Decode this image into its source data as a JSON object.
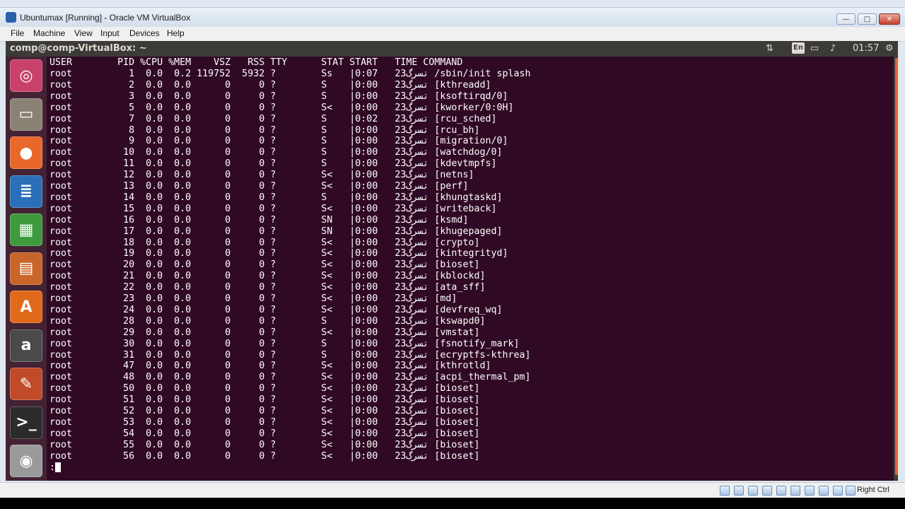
{
  "window": {
    "title": "Ubuntumax [Running] - Oracle VM VirtualBox"
  },
  "menu": [
    "File",
    "Machine",
    "View",
    "Input",
    "Devices",
    "Help"
  ],
  "ubuntu_bar": {
    "title": "comp@comp-VirtualBox: ~",
    "lang": "En",
    "time": "01:57"
  },
  "terminal": {
    "header": "USER        PID %CPU %MEM    VSZ   RSS TTY      STAT START   TIME COMMAND",
    "rows": [
      "root          1  0.0  0.2 119752  5932 ?        Ss   |تسرگ23   0:07 /sbin/init splash",
      "root          2  0.0  0.0      0     0 ?        S    |تسرگ23   0:00 [kthreadd]",
      "root          3  0.0  0.0      0     0 ?        S    |تسرگ23   0:00 [ksoftirqd/0]",
      "root          5  0.0  0.0      0     0 ?        S<   |تسرگ23   0:00 [kworker/0:0H]",
      "root          7  0.0  0.0      0     0 ?        S    |تسرگ23   0:02 [rcu_sched]",
      "root          8  0.0  0.0      0     0 ?        S    |تسرگ23   0:00 [rcu_bh]",
      "root          9  0.0  0.0      0     0 ?        S    |تسرگ23   0:00 [migration/0]",
      "root         10  0.0  0.0      0     0 ?        S    |تسرگ23   0:00 [watchdog/0]",
      "root         11  0.0  0.0      0     0 ?        S    |تسرگ23   0:00 [kdevtmpfs]",
      "root         12  0.0  0.0      0     0 ?        S<   |تسرگ23   0:00 [netns]",
      "root         13  0.0  0.0      0     0 ?        S<   |تسرگ23   0:00 [perf]",
      "root         14  0.0  0.0      0     0 ?        S    |تسرگ23   0:00 [khungtaskd]",
      "root         15  0.0  0.0      0     0 ?        S<   |تسرگ23   0:00 [writeback]",
      "root         16  0.0  0.0      0     0 ?        SN   |تسرگ23   0:00 [ksmd]",
      "root         17  0.0  0.0      0     0 ?        SN   |تسرگ23   0:00 [khugepaged]",
      "root         18  0.0  0.0      0     0 ?        S<   |تسرگ23   0:00 [crypto]",
      "root         19  0.0  0.0      0     0 ?        S<   |تسرگ23   0:00 [kintegrityd]",
      "root         20  0.0  0.0      0     0 ?        S<   |تسرگ23   0:00 [bioset]",
      "root         21  0.0  0.0      0     0 ?        S<   |تسرگ23   0:00 [kblockd]",
      "root         22  0.0  0.0      0     0 ?        S<   |تسرگ23   0:00 [ata_sff]",
      "root         23  0.0  0.0      0     0 ?        S<   |تسرگ23   0:00 [md]",
      "root         24  0.0  0.0      0     0 ?        S<   |تسرگ23   0:00 [devfreq_wq]",
      "root         28  0.0  0.0      0     0 ?        S    |تسرگ23   0:00 [kswapd0]",
      "root         29  0.0  0.0      0     0 ?        S<   |تسرگ23   0:00 [vmstat]",
      "root         30  0.0  0.0      0     0 ?        S    |تسرگ23   0:00 [fsnotify_mark]",
      "root         31  0.0  0.0      0     0 ?        S    |تسرگ23   0:00 [ecryptfs-kthrea]",
      "root         47  0.0  0.0      0     0 ?        S<   |تسرگ23   0:00 [kthrotld]",
      "root         48  0.0  0.0      0     0 ?        S<   |تسرگ23   0:00 [acpi_thermal_pm]",
      "root         50  0.0  0.0      0     0 ?        S<   |تسرگ23   0:00 [bioset]",
      "root         51  0.0  0.0      0     0 ?        S<   |تسرگ23   0:00 [bioset]",
      "root         52  0.0  0.0      0     0 ?        S<   |تسرگ23   0:00 [bioset]",
      "root         53  0.0  0.0      0     0 ?        S<   |تسرگ23   0:00 [bioset]",
      "root         54  0.0  0.0      0     0 ?        S<   |تسرگ23   0:00 [bioset]",
      "root         55  0.0  0.0      0     0 ?        S<   |تسرگ23   0:00 [bioset]",
      "root         56  0.0  0.0      0     0 ?        S<   |تسرگ23   0:00 [bioset]"
    ],
    "prompt": ":"
  },
  "launcher": [
    {
      "name": "ubuntu-dash-icon",
      "glyph": "◎",
      "color": "#c8416b"
    },
    {
      "name": "files-icon",
      "glyph": "▭",
      "color": "#8a8275"
    },
    {
      "name": "firefox-icon",
      "glyph": "●",
      "color": "#e8672a"
    },
    {
      "name": "writer-icon",
      "glyph": "≣",
      "color": "#2a6fb8"
    },
    {
      "name": "calc-icon",
      "glyph": "▦",
      "color": "#3d9a3d"
    },
    {
      "name": "impress-icon",
      "glyph": "▤",
      "color": "#c9652a"
    },
    {
      "name": "software-center-icon",
      "glyph": "A",
      "color": "#e06a1a"
    },
    {
      "name": "amazon-icon",
      "glyph": "a",
      "color": "#4a4a4a"
    },
    {
      "name": "settings-icon",
      "glyph": "✎",
      "color": "#c04a2a"
    },
    {
      "name": "terminal-icon",
      "glyph": ">_",
      "color": "#2b2b2b"
    },
    {
      "name": "dvd-icon",
      "glyph": "◉",
      "color": "#9a9a9a"
    }
  ],
  "statusbar": {
    "host_key": "Right Ctrl"
  }
}
